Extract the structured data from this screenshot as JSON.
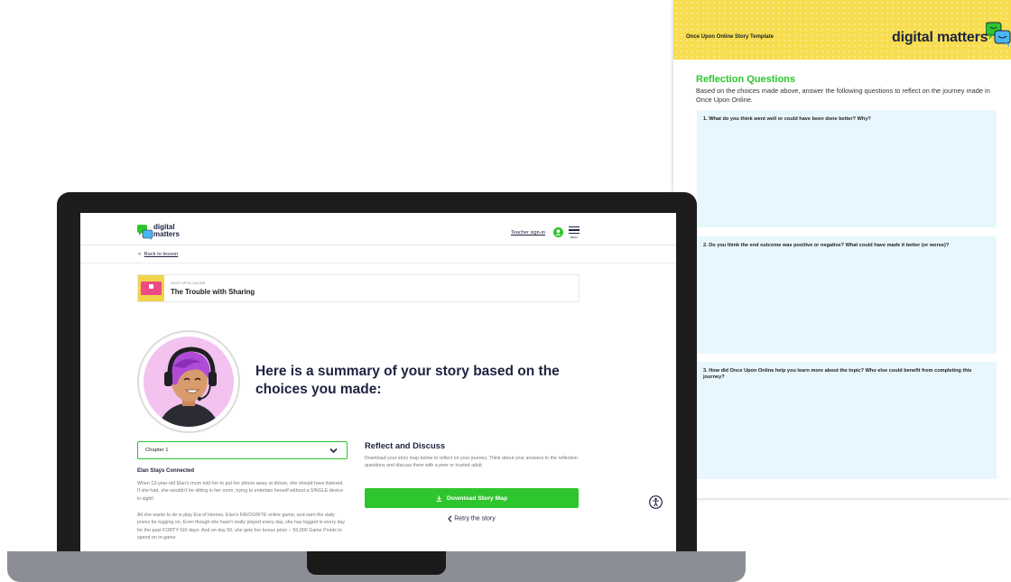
{
  "template_doc": {
    "header_title": "Once Upon Online Story Template",
    "logo_text": "digital matters",
    "heading": "Reflection Questions",
    "intro": "Based on the choices made above, answer the following questions to reflect on the journey made in Once Upon Online.",
    "questions": [
      "1. What do you think went well or could have been done better? Why?",
      "2. Do you think the end outcome was positive or negative? What could have made it better (or worse)?",
      "3. How did Once Upon Online help you learn more about the topic? Who else could benefit from completing this journey?"
    ]
  },
  "site": {
    "logo_line1": "digital",
    "logo_line2": "matters",
    "teacher_signin": "Teacher sign-in",
    "menu_label": "MENU",
    "back_link": "Back to lesson",
    "back_chevron": "<",
    "story_kicker": "ONCE UPON ONLINE",
    "story_title": "The Trouble with Sharing",
    "summary_heading": "Here is a summary of your story based on the choices you made:",
    "chapter_select": "Chapter 1",
    "chapter_title": "Elan Stays Connected",
    "paragraphs": [
      "When 13-year-old Elan's mum told her to put her phone away at dinner, she should have listened. If she had, she wouldn't be sitting in her room, trying to entertain herself without a SINGLE device in sight!",
      "All she wants to do is play Era of Heroes, Elan's FAVOURITE online game, and earn the daily prizes for logging on. Even though she hasn't really played every day, she has logged in every day for the past FORTY-SIX days. And on day 50, she gets her bonus prize -- 50,000 Game Points to spend on in-game"
    ],
    "reflect_heading": "Reflect and Discuss",
    "reflect_text": "Download your story map below to reflect on your journey. Think about your answers to the reflection questions and discuss them with a peer or trusted adult.",
    "download_button": "Download Story Map",
    "retry_link": "Retry the story"
  },
  "icons": [
    "speech-bubbles-logo-icon",
    "user-icon",
    "hamburger-menu-icon",
    "chevron-down-icon",
    "download-icon",
    "chevron-left-icon",
    "accessibility-icon"
  ],
  "colors": {
    "brand_green": "#2ec52e",
    "brand_navy": "#1d2340",
    "header_yellow": "#f7dd4f",
    "question_blue": "#e8f7fd",
    "story_pink": "#ee4a86"
  }
}
